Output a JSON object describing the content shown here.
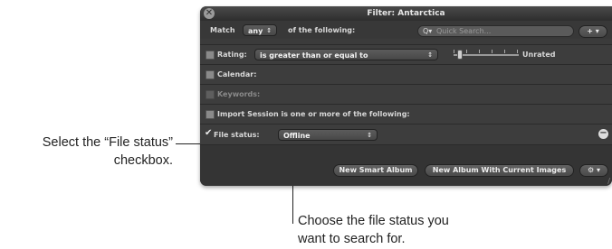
{
  "callouts": {
    "checkbox_line1": "Select the “File status”",
    "checkbox_line2": "checkbox.",
    "status_line1": "Choose the file status you",
    "status_line2": "want to search for."
  },
  "window": {
    "title": "Filter: Antarctica",
    "close_glyph": "✕"
  },
  "match_row": {
    "match_label": "Match",
    "match_value": "any",
    "of_label": "of the following:",
    "search_placeholder": "Quick Search...",
    "search_glyph": "Q▾",
    "add_glyph": "+ ▾"
  },
  "rows": {
    "rating_label": "Rating:",
    "rating_operator": "is greater than or equal to",
    "rating_value": "Unrated",
    "calendar_label": "Calendar:",
    "keywords_label": "Keywords:",
    "import_label": "Import Session is one or more of the following:",
    "file_status_label": "File status:",
    "file_status_value": "Offline",
    "check_glyph": "✔",
    "remove_glyph": "−",
    "popup_arrow": "↕"
  },
  "footer": {
    "new_smart_album": "New Smart Album",
    "new_album_with_images": "New Album With Current Images",
    "action_glyph": "⚙ ▾",
    "resize_glyph": "∕"
  }
}
